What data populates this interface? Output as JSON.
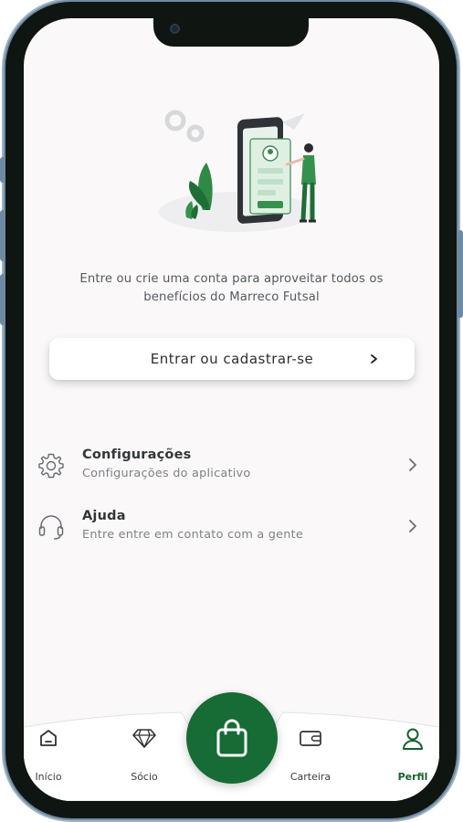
{
  "intro_text": "Entre ou crie uma conta para aproveitar todos os benefícios do Marreco Futsal",
  "login_button": {
    "label": "Entrar ou cadastrar-se",
    "icon": "chevron-right-icon"
  },
  "menu": [
    {
      "title": "Configurações",
      "subtitle": "Configurações do aplicativo",
      "icon": "gear-icon"
    },
    {
      "title": "Ajuda",
      "subtitle": "Entre entre em contato com a gente",
      "icon": "headset-icon"
    }
  ],
  "tabbar": {
    "tabs": [
      {
        "label": "Início",
        "icon": "home-icon",
        "active": false
      },
      {
        "label": "Sócio",
        "icon": "diamond-icon",
        "active": false
      },
      {
        "label": "Carteira",
        "icon": "wallet-icon",
        "active": false
      },
      {
        "label": "Perfil",
        "icon": "user-icon",
        "active": true
      }
    ],
    "center_button_icon": "shopping-bag-icon"
  },
  "colors": {
    "accent": "#176b35",
    "background": "#fbf8fa",
    "text": "#333638",
    "muted": "#7d8286"
  }
}
